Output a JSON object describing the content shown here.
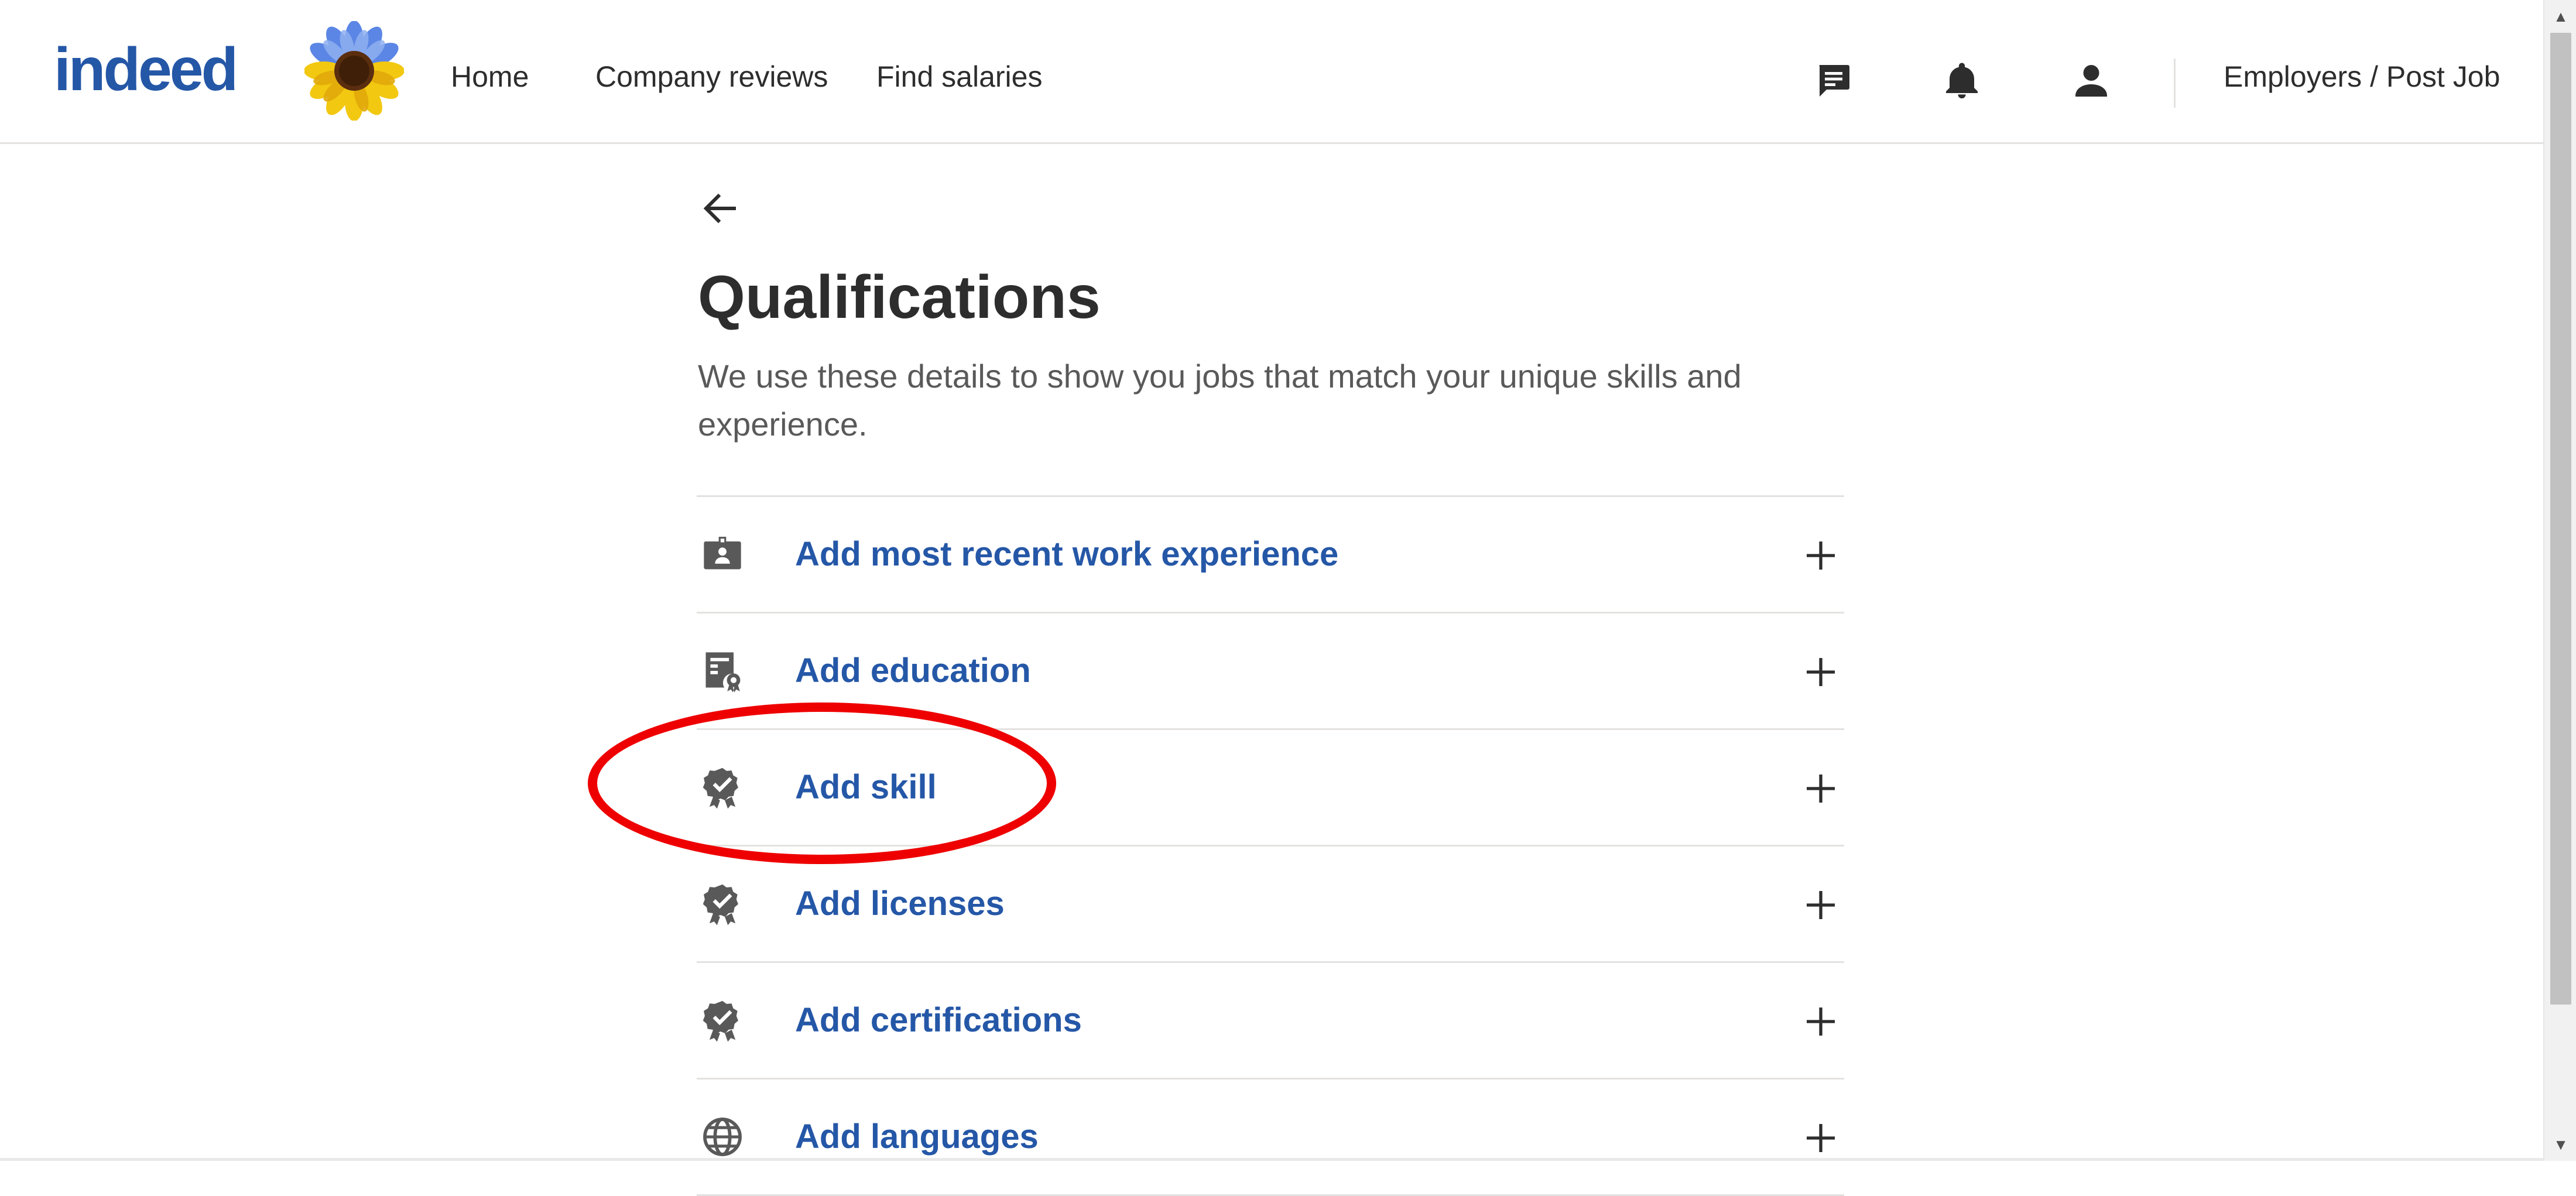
{
  "header": {
    "logo_text": "indeed",
    "nav": [
      {
        "label": "Home"
      },
      {
        "label": "Company reviews"
      },
      {
        "label": "Find salaries"
      }
    ],
    "icons": [
      "messages-icon",
      "notifications-bell-icon",
      "profile-icon"
    ],
    "employers_label": "Employers / Post Job"
  },
  "main": {
    "title": "Qualifications",
    "description": "We use these details to show you jobs that match your unique skills and experience.",
    "items": [
      {
        "label": "Add most recent work experience",
        "icon": "work-badge-icon"
      },
      {
        "label": "Add education",
        "icon": "education-document-icon"
      },
      {
        "label": "Add skill",
        "icon": "award-badge-icon"
      },
      {
        "label": "Add licenses",
        "icon": "award-badge-icon"
      },
      {
        "label": "Add certifications",
        "icon": "award-badge-icon"
      },
      {
        "label": "Add languages",
        "icon": "globe-icon"
      }
    ]
  },
  "colors": {
    "brand_blue": "#2557a7",
    "text": "#2d2d2d",
    "muted_text": "#595959",
    "divider": "#e4e2e0",
    "icon_gray": "#595959",
    "annotation_red": "#ee0000"
  }
}
